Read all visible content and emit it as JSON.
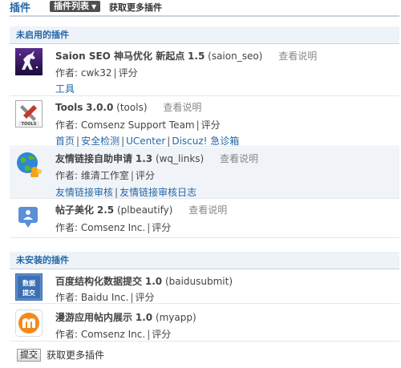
{
  "header": {
    "title": "插件",
    "list_button": "插件列表",
    "get_more": "获取更多插件"
  },
  "disabled_section": {
    "title": "未启用的插件"
  },
  "installed": [
    {
      "name": "Saion SEO 神马优化 新起点",
      "version": "1.5",
      "id": "(saion_seo)",
      "doc": "查看说明",
      "author_prefix": "作者:",
      "author": "cwk32",
      "rating": "评分",
      "links": [
        "工具"
      ],
      "icon": "unicorn-icon"
    },
    {
      "name": "Tools",
      "version": "3.0.0",
      "id": "(tools)",
      "doc": "查看说明",
      "author_prefix": "作者:",
      "author": "Comsenz Support Team",
      "rating": "评分",
      "links": [
        "首页",
        "安全检测",
        "UCenter",
        "Discuz! 急诊箱"
      ],
      "icon": "tools-icon"
    },
    {
      "name": "友情链接自助申请",
      "version": "1.3",
      "id": "(wq_links)",
      "doc": "查看说明",
      "author_prefix": "作者:",
      "author": "维清工作室",
      "rating": "评分",
      "links": [
        "友情链接审核",
        "友情链接审核日志"
      ],
      "icon": "globe-people-icon"
    },
    {
      "name": "帖子美化",
      "version": "2.5",
      "id": "(plbeautify)",
      "doc": "查看说明",
      "author_prefix": "作者:",
      "author": "Comsenz Inc.",
      "rating": "评分",
      "links": [],
      "icon": "post-beautify-icon"
    }
  ],
  "not_installed_section": {
    "title": "未安装的插件"
  },
  "not_installed": [
    {
      "name": "百度结构化数据提交",
      "version": "1.0",
      "id": "(baidusubmit)",
      "author_prefix": "作者:",
      "author": "Baidu Inc.",
      "rating": "评分",
      "icon_text": "数据提交",
      "icon": "data-submit-icon"
    },
    {
      "name": "漫游应用帖内展示",
      "version": "1.0",
      "id": "(myapp)",
      "author_prefix": "作者:",
      "author": "Comsenz Inc.",
      "rating": "评分",
      "icon": "myapp-icon"
    }
  ],
  "footer": {
    "submit": "提交",
    "get_more": "获取更多插件"
  },
  "colors": {
    "link": "#2366a8",
    "section_bg": "#eef3f8",
    "highlight_row": "#f0f4f8"
  }
}
